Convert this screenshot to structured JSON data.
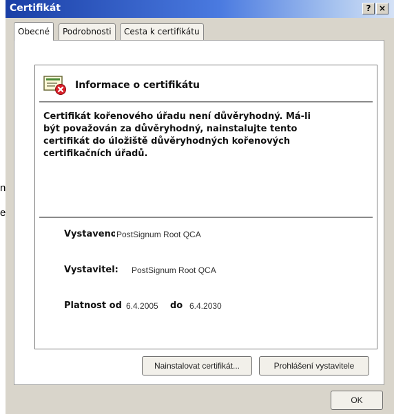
{
  "background": {
    "fragment_1": "n",
    "fragment_2": "e"
  },
  "window": {
    "title": "Certifikát",
    "help_label": "?",
    "close_label": "×"
  },
  "tabs": [
    {
      "label": "Obecné"
    },
    {
      "label": "Podrobnosti"
    },
    {
      "label": "Cesta k certifikátu"
    }
  ],
  "info": {
    "title": "Informace o certifikátu",
    "message": "Certifikát kořenového úřadu není důvěryhodný. Má-li být považován za důvěryhodný, nainstalujte tento certifikát do úložiště důvěryhodných kořenových certifikačních úřadů."
  },
  "fields": {
    "issued_to_label": "Vystaveno pro",
    "issued_to_value": "PostSignum Root QCA",
    "issuer_label": "Vystavitel:",
    "issuer_value": "PostSignum Root QCA",
    "valid_from_label": "Platnost od",
    "valid_from_value": "6.4.2005",
    "valid_to_label": "do",
    "valid_to_value": "6.4.2030"
  },
  "buttons": {
    "install": "Nainstalovat certifikát...",
    "issuer_statement": "Prohlášení vystavitele",
    "ok": "OK"
  },
  "colors": {
    "titlebar": "#1a3fa6",
    "dialog": "#d9d5cb",
    "warning": "#d9202a"
  }
}
